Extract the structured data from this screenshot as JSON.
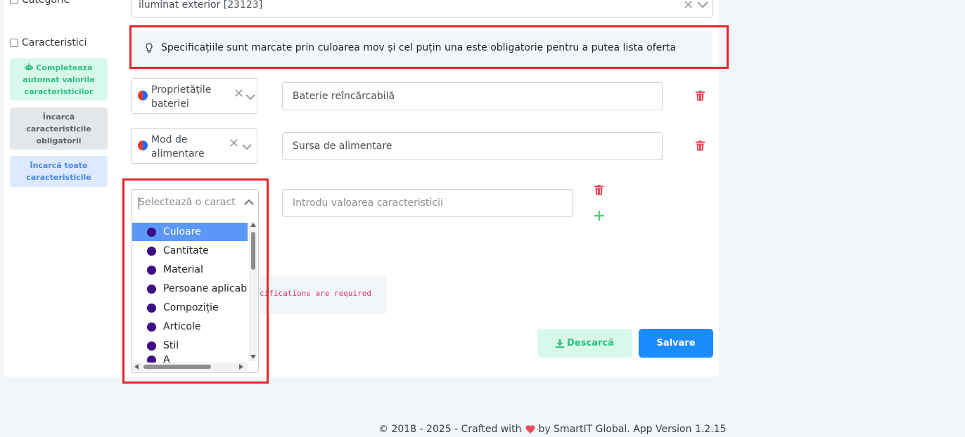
{
  "sidebar": {
    "category_label": "Categorie",
    "characteristics_label": "Caracteristici",
    "auto_fill_button": "Completează automat valorile caracteristicilor",
    "load_required_button": "Încarcă caracteristicile obligatorii",
    "load_all_button": "Încarcă toate caracteristicile"
  },
  "category_select": {
    "value": "iluminat exterior [23123]"
  },
  "notice": {
    "text": "Specificațiile sunt marcate prin culoarea mov și cel puțin una este obligatorie pentru a putea lista oferta"
  },
  "rows": [
    {
      "attribute": "Proprietățile bateriei",
      "value": "Baterie reîncărcabilă"
    },
    {
      "attribute": "Mod de alimentare",
      "value": "Sursa de alimentare"
    }
  ],
  "new_row": {
    "select_placeholder": "Selectează o caracteristică",
    "value_placeholder": "Introdu valoarea caracteristicii"
  },
  "dropdown": {
    "options": [
      "Culoare",
      "Cantitate",
      "Material",
      "Persoane aplicabile",
      "Compoziție",
      "Articole",
      "Stil",
      "A"
    ],
    "selected": "Culoare"
  },
  "error": {
    "text": "cifications are required"
  },
  "actions": {
    "download_label": "Descarcă",
    "save_label": "Salvare"
  },
  "footer": {
    "text_before": "© 2018 - 2025 - Crafted with",
    "text_after": "by SmartIT Global. App Version 1.2.15"
  },
  "colors": {
    "highlight_border": "#e5262b",
    "spec_dot": "#3d0e86",
    "primary": "#1a8cff",
    "delete": "#e8495b",
    "add": "#4cd07d"
  },
  "icons": [
    "bulb-icon",
    "robot-icon",
    "clear-icon",
    "chevron-down-icon",
    "chevron-up-icon",
    "trash-icon",
    "plus-icon",
    "download-icon",
    "heart-icon"
  ]
}
